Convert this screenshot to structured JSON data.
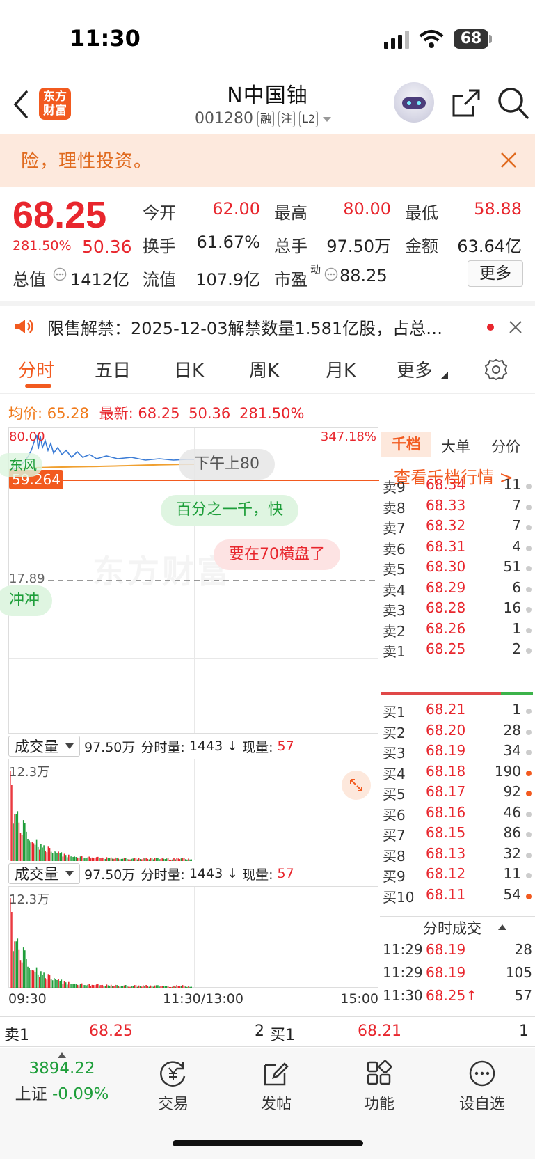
{
  "status": {
    "time": "11:30",
    "battery": "68"
  },
  "header": {
    "logo_line1": "东方",
    "logo_line2": "财富",
    "stock_name": "N中国铀",
    "stock_code": "001280",
    "tags": [
      "融",
      "注",
      "L2"
    ]
  },
  "banner": {
    "text": "险，理性投资。"
  },
  "quote": {
    "price": "68.25",
    "change_pct": "281.50%",
    "change": "50.36",
    "open_label": "今开",
    "open": "62.00",
    "high_label": "最高",
    "high": "80.00",
    "low_label": "最低",
    "low": "58.88",
    "turnover_label": "换手",
    "turnover": "61.67%",
    "volume_label": "总手",
    "volume": "97.50万",
    "amount_label": "金额",
    "amount": "63.64亿",
    "mcap_label": "总值",
    "mcap": "1412亿",
    "float_label": "流值",
    "float": "107.9亿",
    "pe_label": "市盈",
    "pe_sup": "动",
    "pe": "88.25",
    "more": "更多"
  },
  "notice": {
    "text": "限售解禁：2025-12-03解禁数量1.581亿股，占总…"
  },
  "tabs": [
    "分时",
    "五日",
    "日K",
    "周K",
    "月K",
    "更多"
  ],
  "summary": {
    "avg_label": "均价:",
    "avg": "65.28",
    "last_label": "最新:",
    "last": "68.25",
    "chg": "50.36",
    "pct": "281.50%"
  },
  "chart": {
    "top_price": "80.00",
    "top_pct": "347.18%",
    "ref_price": "59.264",
    "mid_price": "17.89",
    "left_tag1": "东风",
    "left_tag2": "冲冲",
    "comments": [
      "下午上80",
      "百分之一千，快",
      "要在70横盘了"
    ],
    "watermark": "东方财富",
    "time_start": "09:30",
    "time_mid": "11:30/13:00",
    "time_end": "15:00"
  },
  "volume1": {
    "select": "成交量",
    "total": "97.50万",
    "fenshi_label": "分时量:",
    "fenshi": "1443",
    "now_label": "现量:",
    "now": "57",
    "max": "12.3万"
  },
  "volume2": {
    "select": "成交量",
    "total": "97.50万",
    "fenshi_label": "分时量:",
    "fenshi": "1443",
    "now_label": "现量:",
    "now": "57",
    "max": "12.3万"
  },
  "book": {
    "tabs": [
      "千档",
      "大单",
      "分价"
    ],
    "link": "查看千档行情 >",
    "asks": [
      {
        "label": "卖9",
        "price": "68.34",
        "vol": "11"
      },
      {
        "label": "卖8",
        "price": "68.33",
        "vol": "7"
      },
      {
        "label": "卖7",
        "price": "68.32",
        "vol": "7"
      },
      {
        "label": "卖6",
        "price": "68.31",
        "vol": "4"
      },
      {
        "label": "卖5",
        "price": "68.30",
        "vol": "51"
      },
      {
        "label": "卖4",
        "price": "68.29",
        "vol": "6"
      },
      {
        "label": "卖3",
        "price": "68.28",
        "vol": "16"
      },
      {
        "label": "卖2",
        "price": "68.26",
        "vol": "1"
      },
      {
        "label": "卖1",
        "price": "68.25",
        "vol": "2"
      }
    ],
    "bids": [
      {
        "label": "买1",
        "price": "68.21",
        "vol": "1"
      },
      {
        "label": "买2",
        "price": "68.20",
        "vol": "28"
      },
      {
        "label": "买3",
        "price": "68.19",
        "vol": "34"
      },
      {
        "label": "买4",
        "price": "68.18",
        "vol": "190"
      },
      {
        "label": "买5",
        "price": "68.17",
        "vol": "92"
      },
      {
        "label": "买6",
        "price": "68.16",
        "vol": "46"
      },
      {
        "label": "买7",
        "price": "68.15",
        "vol": "86"
      },
      {
        "label": "买8",
        "price": "68.13",
        "vol": "32"
      },
      {
        "label": "买9",
        "price": "68.12",
        "vol": "11"
      },
      {
        "label": "买10",
        "price": "68.11",
        "vol": "54"
      }
    ],
    "trades_title": "分时成交",
    "trades": [
      {
        "time": "11:29",
        "price": "68.19",
        "vol": "28"
      },
      {
        "time": "11:29",
        "price": "68.19",
        "vol": "105"
      },
      {
        "time": "11:30",
        "price": "68.25↑",
        "vol": "57"
      }
    ]
  },
  "bottom_quote": {
    "sell_label": "卖1",
    "sell_price": "68.25",
    "sell_vol": "2",
    "buy_label": "买1",
    "buy_price": "68.21",
    "buy_vol": "1"
  },
  "footer": {
    "index_value": "3894.22",
    "index_name": "上证",
    "index_change": "-0.09%",
    "items": [
      "交易",
      "发帖",
      "功能",
      "设自选"
    ]
  },
  "colors": {
    "up": "#e8262d",
    "down": "#1e9e3a",
    "accent": "#f25a1f",
    "avg_line": "#f0a030",
    "price_line": "#3a7bd5"
  }
}
